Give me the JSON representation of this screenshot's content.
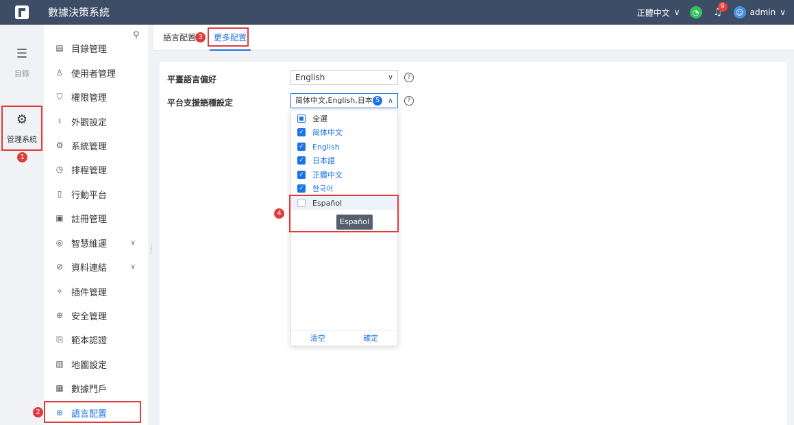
{
  "app": {
    "title": "數據決策系統"
  },
  "topbar": {
    "language": "正體中文",
    "notice_count": "9",
    "user": "admin"
  },
  "rail": {
    "items": [
      {
        "label": "目錄",
        "icon": "list-icon"
      },
      {
        "label": "管理系統",
        "icon": "gear-icon"
      }
    ]
  },
  "menu": {
    "items": [
      {
        "label": "目錄管理",
        "icon": "catalog-icon"
      },
      {
        "label": "使用者管理",
        "icon": "user-icon"
      },
      {
        "label": "權限管理",
        "icon": "shield-icon"
      },
      {
        "label": "外觀設定",
        "icon": "brush-icon"
      },
      {
        "label": "系統管理",
        "icon": "settings-icon"
      },
      {
        "label": "排程管理",
        "icon": "clock-icon"
      },
      {
        "label": "行動平台",
        "icon": "mobile-icon"
      },
      {
        "label": "註冊管理",
        "icon": "register-icon"
      },
      {
        "label": "智慧維運",
        "icon": "ops-icon",
        "expandable": true
      },
      {
        "label": "資料連結",
        "icon": "link-icon",
        "expandable": true
      },
      {
        "label": "插件管理",
        "icon": "plugin-icon"
      },
      {
        "label": "安全管理",
        "icon": "security-icon"
      },
      {
        "label": "範本認證",
        "icon": "template-icon"
      },
      {
        "label": "地圖設定",
        "icon": "map-icon"
      },
      {
        "label": "數據門戶",
        "icon": "portal-icon"
      },
      {
        "label": "語言配置",
        "icon": "globe-icon",
        "active": true
      }
    ]
  },
  "tabs": [
    {
      "label": "語言配置"
    },
    {
      "label": "更多配置",
      "active": true
    }
  ],
  "form": {
    "lang_pref_label": "平臺語言偏好",
    "lang_pref_value": "English",
    "support_label": "平台支援語種設定",
    "support_value": "简体中文,English,日本...",
    "support_count": "5"
  },
  "dropdown": {
    "options": [
      {
        "label": "全選",
        "state": "partial"
      },
      {
        "label": "简体中文",
        "state": "checked"
      },
      {
        "label": "English",
        "state": "checked"
      },
      {
        "label": "日本語",
        "state": "checked"
      },
      {
        "label": "正體中文",
        "state": "checked"
      },
      {
        "label": "한국어",
        "state": "checked"
      },
      {
        "label": "Español",
        "state": "unchecked"
      }
    ],
    "tooltip": "Español",
    "clear_label": "清空",
    "confirm_label": "確定"
  },
  "annotations": {
    "steps": [
      "1",
      "2",
      "3",
      "4"
    ],
    "color": "#e03a3a"
  },
  "colors": {
    "topbar": "#3d4d66",
    "accent": "#1a73e8"
  }
}
